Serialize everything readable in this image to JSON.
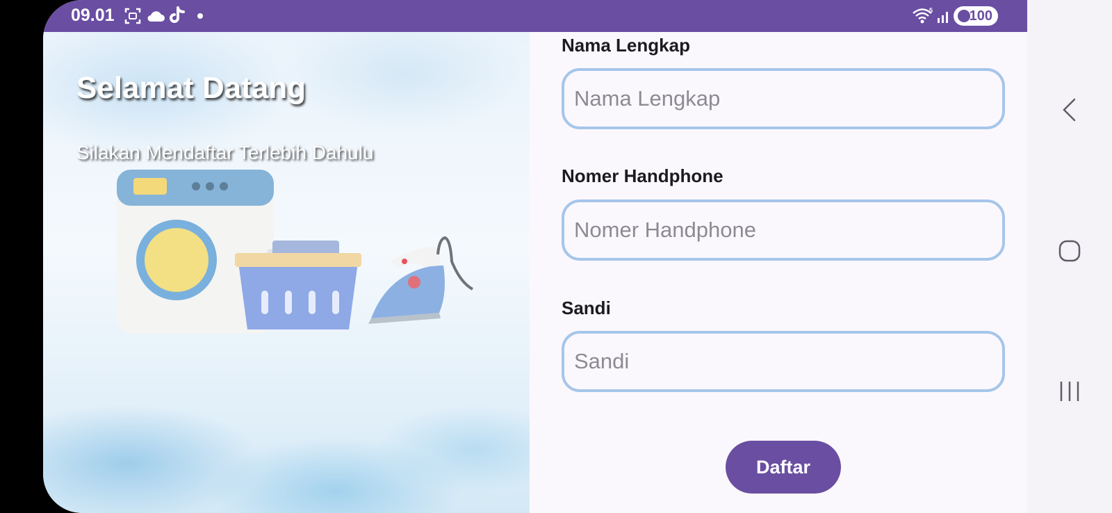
{
  "status_bar": {
    "time": "09.01",
    "battery_level": "100",
    "icons": [
      "screenshot-icon",
      "cloud-icon",
      "tiktok-icon",
      "notification-dot",
      "wifi-icon",
      "signal-icon",
      "battery-icon"
    ]
  },
  "hero": {
    "title": "Selamat Datang",
    "subtitle": "Silakan Mendaftar Terlebih Dahulu",
    "illustration": "laundry-illustration"
  },
  "form": {
    "full_name": {
      "label": "Nama Lengkap",
      "placeholder": "Nama Lengkap",
      "value": ""
    },
    "phone": {
      "label": "Nomer Handphone",
      "placeholder": "Nomer Handphone",
      "value": ""
    },
    "password": {
      "label": "Sandi",
      "placeholder": "Sandi",
      "value": ""
    },
    "submit_label": "Daftar"
  },
  "nav_bar": {
    "icons": [
      "back-icon",
      "home-icon",
      "recents-icon"
    ]
  },
  "colors": {
    "primary": "#6a4ea2",
    "input_border": "#a6c6ea",
    "background": "#fbf8fd",
    "text": "#1c1b1f",
    "placeholder": "#8e8a92"
  }
}
